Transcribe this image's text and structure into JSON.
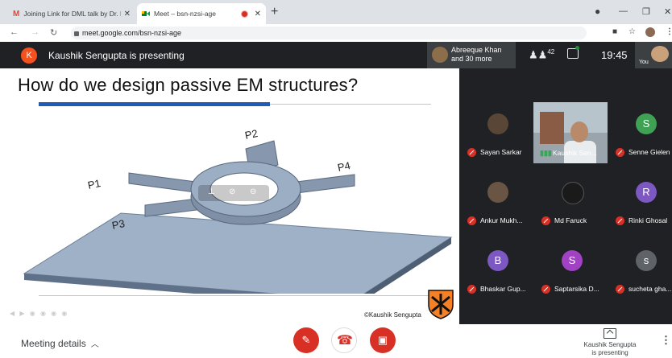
{
  "browser": {
    "tabs": [
      {
        "title": "Joining Link for DML talk by Dr. Kau",
        "icon": "gmail-icon"
      },
      {
        "title": "Meet – bsn-nzsi-age",
        "icon": "meet-icon",
        "recording": true
      }
    ],
    "url": "meet.google.com/bsn-nzsi-age"
  },
  "header": {
    "presenter_initial": "K",
    "presenting_text": "Kaushik Sengupta is presenting",
    "group_text_line1": "Abreeque Khan",
    "group_text_line2": "and 30 more",
    "people_icon": "people-icon",
    "people_count": "42",
    "time": "19:45",
    "you_label": "You"
  },
  "slide": {
    "title": "How do we design passive EM structures?",
    "ports": [
      "P1",
      "P2",
      "P3",
      "P4"
    ],
    "credit": "©Kaushik Sengupta"
  },
  "participants": [
    {
      "name": "Sayan Sarkar",
      "avatar": "photo",
      "muted": true
    },
    {
      "name": "Kaushik Sen...",
      "avatar": "video",
      "muted": false,
      "speaking": true
    },
    {
      "name": "Senne Gielen",
      "initial": "S",
      "color": "#3ea153",
      "muted": true
    },
    {
      "name": "Ankur Mukh...",
      "avatar": "photo",
      "muted": true
    },
    {
      "name": "Md Faruck",
      "avatar": "photo",
      "muted": true
    },
    {
      "name": "Rinki Ghosal",
      "initial": "R",
      "color": "#7d58c2",
      "muted": true
    },
    {
      "name": "Bhaskar Gup...",
      "initial": "B",
      "color": "#7d58c2",
      "muted": true
    },
    {
      "name": "Saptarsika D...",
      "initial": "S",
      "color": "#a142c4",
      "muted": true
    },
    {
      "name": "sucheta gha...",
      "initial": "s",
      "color": "#5f6368",
      "muted": true
    }
  ],
  "bottom": {
    "meeting_details": "Meeting details",
    "presenting_line1": "Kaushik Sengupta",
    "presenting_line2": "is presenting"
  },
  "colors": {
    "danger": "#d93025",
    "meet_dark": "#202124",
    "slide_accent": "#1f5cb5"
  }
}
